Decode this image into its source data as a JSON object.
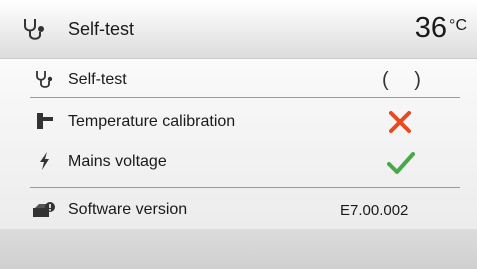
{
  "header": {
    "title": "Self-test",
    "temperature": "36",
    "unit": "°C",
    "icon": "stethoscope-icon"
  },
  "rows": [
    {
      "label": "Self-test",
      "icon": "stethoscope-icon",
      "status": "running",
      "status_glyph": "( )"
    },
    {
      "label": "Temperature calibration",
      "icon": "calibration-icon",
      "status": "failed",
      "status_glyph": "✗",
      "color": "#e8491f"
    },
    {
      "label": "Mains voltage",
      "icon": "lightning-icon",
      "status": "passed",
      "status_glyph": "✓",
      "color": "#49a94a"
    },
    {
      "label": "Software version",
      "icon": "software-icon",
      "value": "E7.00.002"
    }
  ]
}
